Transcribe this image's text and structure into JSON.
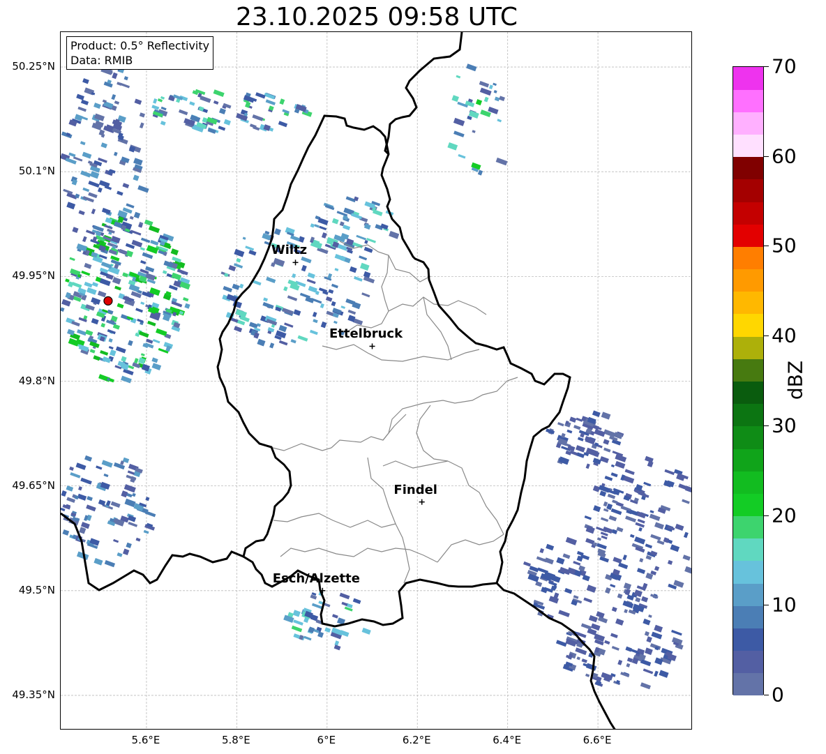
{
  "title": "23.10.2025 09:58 UTC",
  "info": {
    "product": "Product: 0.5° Reflectivity",
    "source": "Data: RMIB"
  },
  "axes": {
    "lat_labels": [
      "50.25°N",
      "50.1°N",
      "49.95°N",
      "49.8°N",
      "49.65°N",
      "49.5°N",
      "49.35°N"
    ],
    "lon_labels": [
      "5.6°E",
      "5.8°E",
      "6°E",
      "6.2°E",
      "6.4°E",
      "6.6°E"
    ],
    "lat_values": [
      50.25,
      50.1,
      49.95,
      49.8,
      49.65,
      49.5,
      49.35
    ],
    "lon_values": [
      5.6,
      5.8,
      6.0,
      6.2,
      6.4,
      6.6
    ],
    "lon_range": [
      5.41,
      6.81
    ],
    "lat_range": [
      49.3,
      50.3
    ]
  },
  "cities": [
    {
      "name": "Wiltz",
      "lon": 5.93,
      "lat": 49.97
    },
    {
      "name": "Ettelbruck",
      "lon": 6.1,
      "lat": 49.85
    },
    {
      "name": "Findel",
      "lon": 6.21,
      "lat": 49.627
    },
    {
      "name": "Esch/Alzette",
      "lon": 5.99,
      "lat": 49.5
    }
  ],
  "radar_site": {
    "lon": 5.515,
    "lat": 49.915,
    "color": "#dd0000"
  },
  "colorbar": {
    "label": "dBZ",
    "min": 0,
    "max": 70,
    "tick_labels": [
      "0",
      "10",
      "20",
      "30",
      "40",
      "50",
      "60",
      "70"
    ],
    "tick_values": [
      0,
      10,
      20,
      30,
      40,
      50,
      60,
      70
    ],
    "colors": [
      "#6373a8",
      "#535fa3",
      "#3d5aa5",
      "#4b7eb5",
      "#5a9ec8",
      "#67c2dc",
      "#60d8c0",
      "#3dd46e",
      "#13cc25",
      "#12bc20",
      "#10a41a",
      "#0f8c16",
      "#0c7512",
      "#0a5c0e",
      "#477a10",
      "#adb00a",
      "#ffd700",
      "#ffb800",
      "#ff9a00",
      "#ff7e00",
      "#e30000",
      "#c40000",
      "#a40000",
      "#800000",
      "#ffe0ff",
      "#ffb0ff",
      "#ff70ff",
      "#ee33ee"
    ]
  }
}
